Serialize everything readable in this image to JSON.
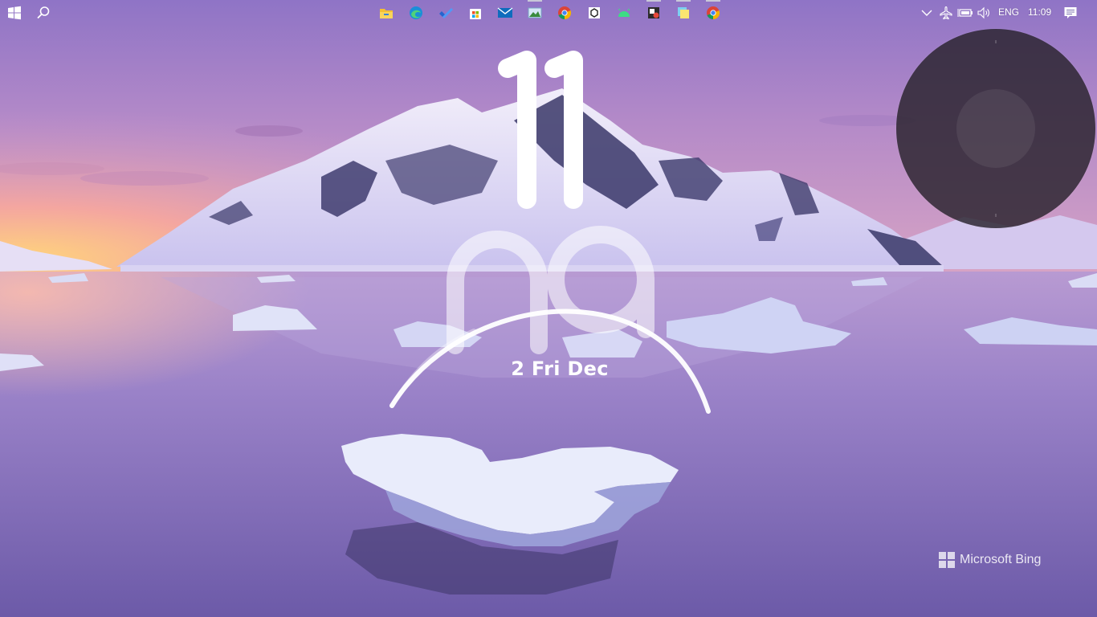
{
  "taskbar": {
    "start_icon": "windows-logo-icon",
    "search_icon": "search-icon",
    "apps": [
      {
        "name": "file-explorer-icon",
        "running": false
      },
      {
        "name": "edge-icon",
        "running": false
      },
      {
        "name": "todo-icon",
        "running": false
      },
      {
        "name": "store-icon",
        "running": false
      },
      {
        "name": "mail-icon",
        "running": false
      },
      {
        "name": "photos-icon",
        "running": true
      },
      {
        "name": "chrome-icon",
        "running": false
      },
      {
        "name": "unity-icon",
        "running": false
      },
      {
        "name": "android-icon",
        "running": false
      },
      {
        "name": "snipping-icon",
        "running": true
      },
      {
        "name": "sticky-notes-icon",
        "running": true
      },
      {
        "name": "chrome-icon",
        "running": true
      }
    ],
    "tray": {
      "language": "ENG",
      "time": "11:09"
    }
  },
  "clock_widget": {
    "hour": "11",
    "minute": "09",
    "date": "2 Fri Dec"
  },
  "watermark": {
    "text": "Microsoft Bing"
  },
  "colors": {
    "sky_top": "#8f78c8",
    "sky_horizon": "#f2c48a",
    "water": "#7a68b8",
    "orb": "#28222c"
  }
}
